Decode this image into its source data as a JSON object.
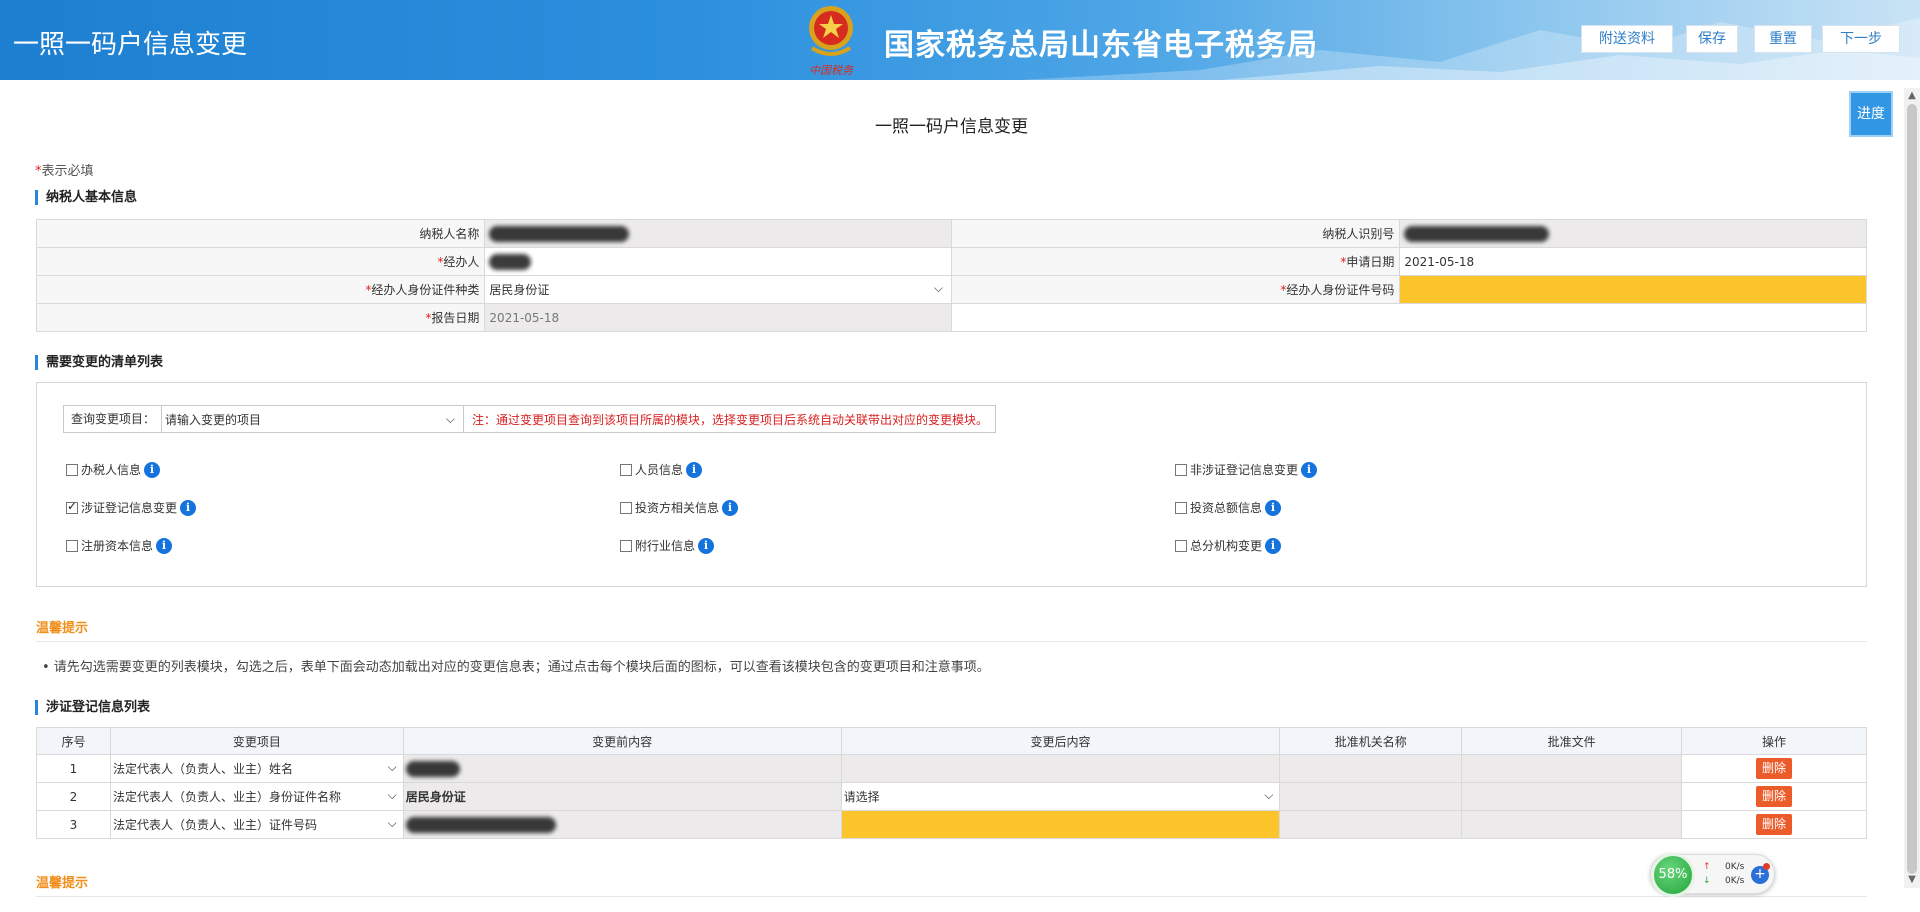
{
  "header": {
    "app_title": "一照一码户信息变更",
    "site_title": "国家税务总局山东省电子税务局",
    "emblem_caption": "中国税务",
    "buttons": {
      "attach": "附送资料",
      "save": "保存",
      "reset": "重置",
      "next": "下一步"
    }
  },
  "progress_button": "进度",
  "page_heading": "一照一码户信息变更",
  "required_note": {
    "star": "*",
    "text": "表示必填"
  },
  "basic_info": {
    "section_title": "纳税人基本信息",
    "taxpayer_name_label": "纳税人名称",
    "taxpayer_id_label": "纳税人识别号",
    "handler_label": "经办人",
    "apply_date_label": "申请日期",
    "apply_date": "2021-05-18",
    "id_type_label": "经办人身份证件种类",
    "id_type": "居民身份证",
    "id_number_label": "经办人身份证件号码",
    "report_date_label": "报告日期",
    "report_date": "2021-05-18"
  },
  "change_list": {
    "section_title": "需要变更的清单列表",
    "query_label": "查询变更项目：",
    "query_placeholder": "请输入变更的项目",
    "query_note": "注：通过变更项目查询到该项目所属的模块，选择变更项目后系统自动关联带出对应的变更模块。",
    "items": [
      {
        "label": "办税人信息",
        "checked": false
      },
      {
        "label": "人员信息",
        "checked": false
      },
      {
        "label": "非涉证登记信息变更",
        "checked": false
      },
      {
        "label": "涉证登记信息变更",
        "checked": true
      },
      {
        "label": "投资方相关信息",
        "checked": false
      },
      {
        "label": "投资总额信息",
        "checked": false
      },
      {
        "label": "注册资本信息",
        "checked": false
      },
      {
        "label": "附行业信息",
        "checked": false
      },
      {
        "label": "总分机构变更",
        "checked": false
      }
    ]
  },
  "tips": {
    "title": "温馨提示",
    "text": "• 请先勾选需要变更的列表模块，勾选之后，表单下面会动态加载出对应的变更信息表；通过点击每个模块后面的图标，可以查看该模块包含的变更项目和注意事项。",
    "title2": "温馨提示"
  },
  "registration": {
    "section_title": "涉证登记信息列表",
    "columns": [
      "序号",
      "变更项目",
      "变更前内容",
      "变更后内容",
      "批准机关名称",
      "批准文件",
      "操作"
    ],
    "rows": [
      {
        "no": "1",
        "item": "法定代表人（负责人、业主）姓名",
        "before": "",
        "after": "",
        "action": "删除"
      },
      {
        "no": "2",
        "item": "法定代表人（负责人、业主）身份证件名称",
        "before": "居民身份证",
        "after": "请选择",
        "action": "删除"
      },
      {
        "no": "3",
        "item": "法定代表人（负责人、业主）证件号码",
        "before": "",
        "after": "",
        "action": "删除"
      }
    ]
  },
  "net_widget": {
    "percent": "58%",
    "up": "0K/s",
    "down": "0K/s"
  },
  "colors": {
    "header_blue": "#2b8fde",
    "required_red": "#e02020",
    "highlight_yellow": "#fbc52b",
    "tip_orange": "#f08f1c",
    "delete_orange": "#ec5b2a"
  }
}
